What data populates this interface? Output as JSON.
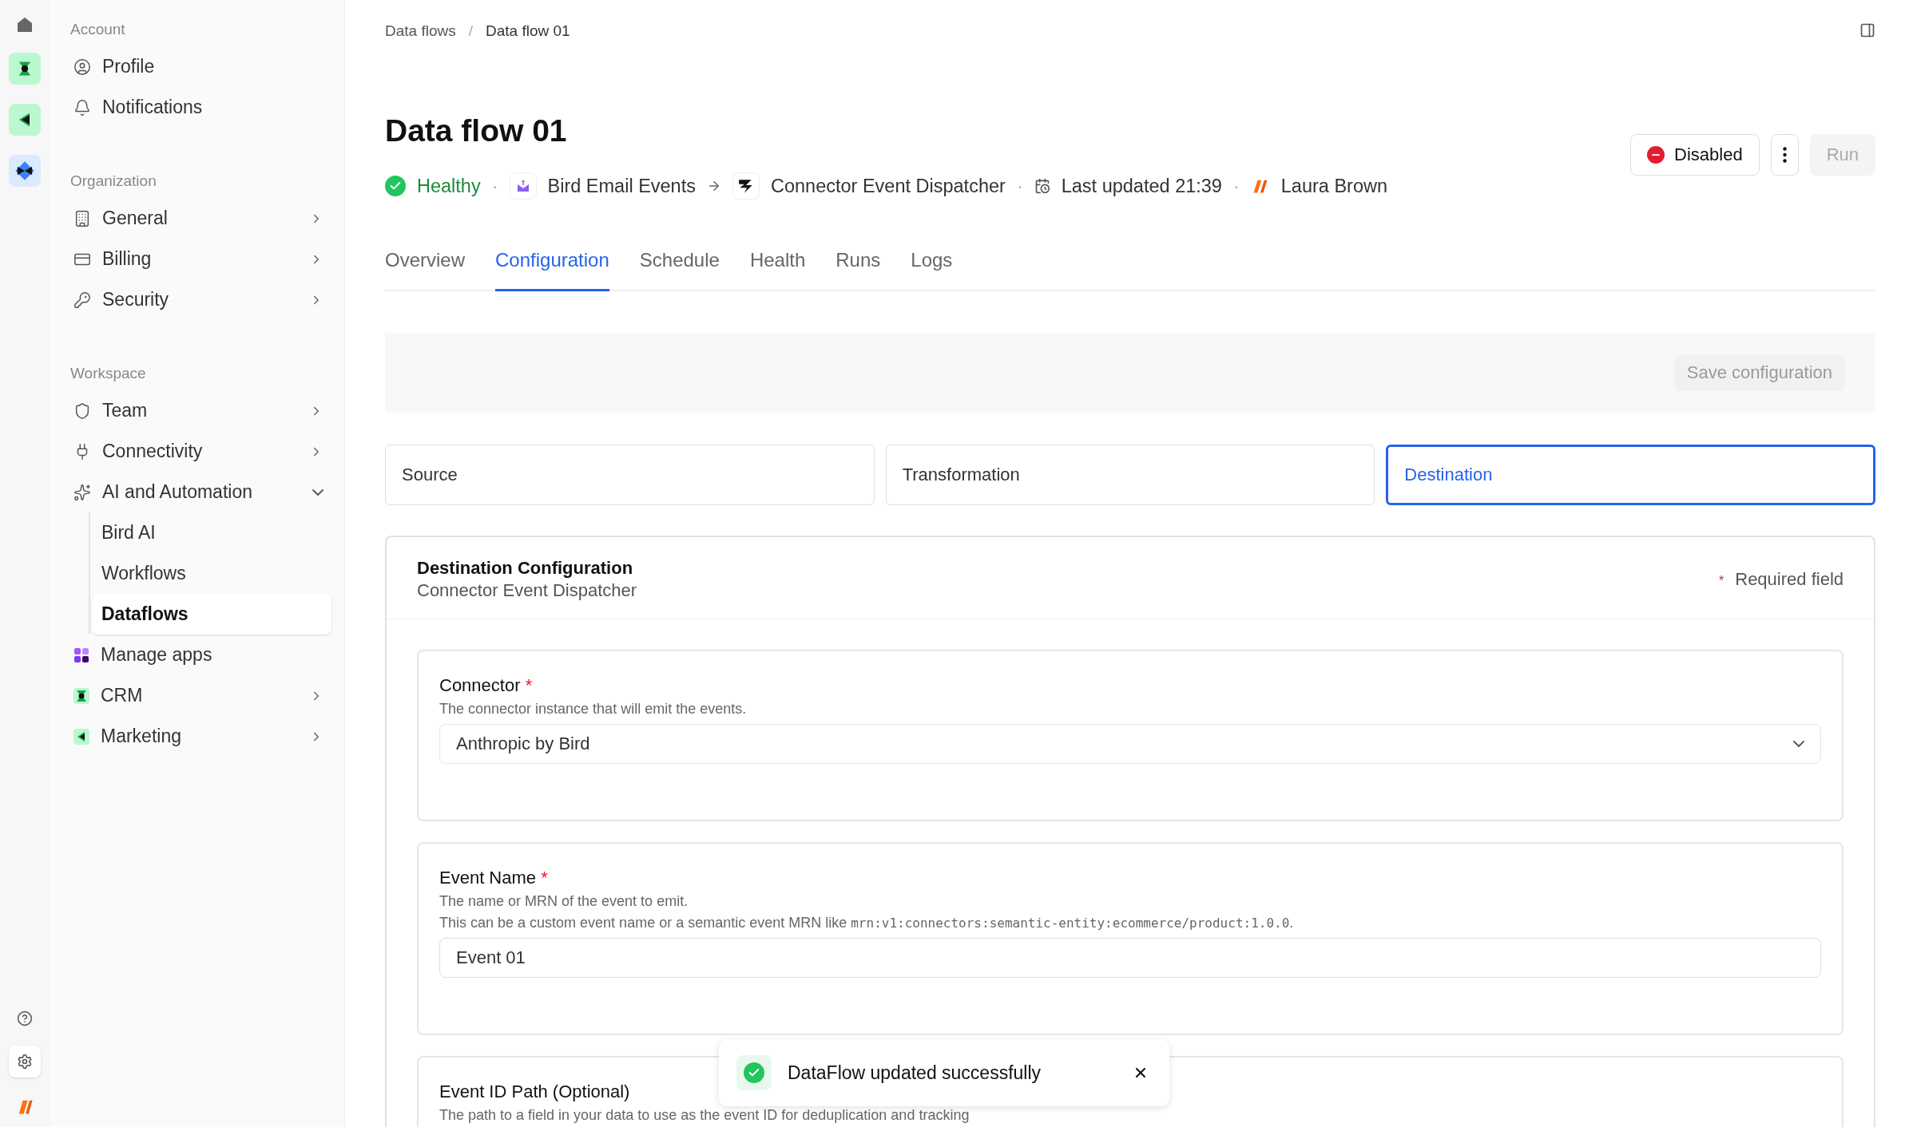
{
  "sidebar": {
    "sections": [
      {
        "label": "Account",
        "items": [
          {
            "label": "Profile",
            "selected": false
          },
          {
            "label": "Notifications",
            "selected": false
          }
        ]
      },
      {
        "label": "Organization",
        "items": [
          {
            "label": "General",
            "selected": false,
            "expanded": false
          },
          {
            "label": "Billing",
            "selected": false,
            "expanded": false
          },
          {
            "label": "Security",
            "selected": false,
            "expanded": false
          }
        ]
      },
      {
        "label": "Workspace",
        "items": [
          {
            "label": "Team",
            "selected": false,
            "expanded": false
          },
          {
            "label": "Connectivity",
            "selected": false,
            "expanded": false
          },
          {
            "label": "AI and Automation",
            "selected": false,
            "expanded": true,
            "children": [
              {
                "label": "Bird AI",
                "selected": false
              },
              {
                "label": "Workflows",
                "selected": false
              },
              {
                "label": "Dataflows",
                "selected": true
              }
            ]
          },
          {
            "label": "Manage apps",
            "selected": false
          },
          {
            "label": "CRM",
            "selected": false,
            "expanded": false
          },
          {
            "label": "Marketing",
            "selected": false,
            "expanded": false
          }
        ]
      }
    ]
  },
  "breadcrumb": [
    "Data flows",
    "Data flow 01"
  ],
  "breadcrumb_separator": "/",
  "title": "Data flow 01",
  "meta": {
    "status": "Healthy",
    "source": "Bird Email Events",
    "destination": "Connector Event Dispatcher",
    "updated": "Last updated 21:39",
    "owner": "Laura Brown",
    "separator": "·"
  },
  "actions": {
    "state_button": "Disabled",
    "run": {
      "label": "Run",
      "disabled": true
    }
  },
  "tabs": [
    {
      "label": "Overview",
      "selected": false
    },
    {
      "label": "Configuration",
      "selected": true
    },
    {
      "label": "Schedule",
      "selected": false
    },
    {
      "label": "Health",
      "selected": false
    },
    {
      "label": "Runs",
      "selected": false
    },
    {
      "label": "Logs",
      "selected": false
    }
  ],
  "save": {
    "label": "Save configuration",
    "disabled": true
  },
  "steps": [
    {
      "label": "Source",
      "selected": false
    },
    {
      "label": "Transformation",
      "selected": false
    },
    {
      "label": "Destination",
      "selected": true
    }
  ],
  "config": {
    "title": "Destination Configuration",
    "subtitle": "Connector Event Dispatcher",
    "required_mark": "*",
    "required_note": "Required field",
    "fields": [
      {
        "kind": "select",
        "label": "Connector",
        "required": true,
        "description": "The connector instance that will emit the events.",
        "value": "Anthropic by Bird"
      },
      {
        "kind": "text",
        "label": "Event Name",
        "required": true,
        "description": "The name or MRN of the event to emit.",
        "note": {
          "text": "This can be a custom event name or a semantic event MRN like ",
          "code": "mrn:v1:connectors:semantic-entity:ecommerce/product:1.0.0",
          "suffix": "."
        },
        "value": "Event 01"
      },
      {
        "label": "Event ID Path (Optional)",
        "required": false,
        "description": "The path to a field in your data to use as the event ID for deduplication and tracking"
      }
    ]
  },
  "toast": {
    "message": "DataFlow updated successfully"
  }
}
